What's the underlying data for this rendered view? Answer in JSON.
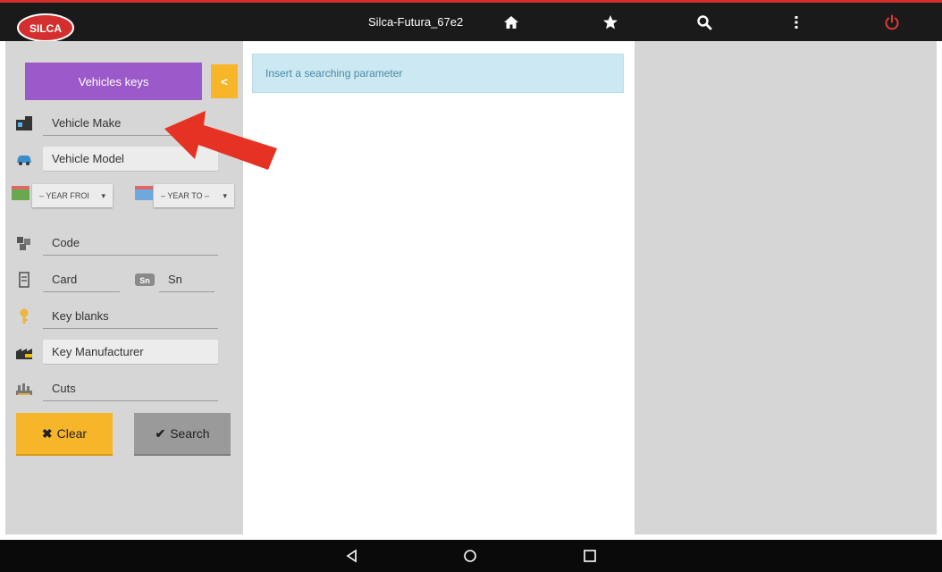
{
  "header": {
    "logo_text": "SILCA",
    "title": "Silca-Futura_67e2",
    "icons": [
      "home-icon",
      "star-icon",
      "search-icon",
      "more-vert-icon",
      "power-icon"
    ]
  },
  "sidebar": {
    "vehicles_keys_label": "Vehicles keys",
    "collapse_label": "<",
    "vehicle_make": "Vehicle Make",
    "vehicle_model": "Vehicle Model",
    "year_from": "– YEAR FROI",
    "year_to": "– YEAR TO –",
    "code": "Code",
    "card": "Card",
    "sn": "Sn",
    "key_blanks": "Key blanks",
    "key_manufacturer": "Key Manufacturer",
    "cuts": "Cuts",
    "clear_label": "Clear",
    "search_label": "Search"
  },
  "main": {
    "info_message": "Insert a searching parameter"
  },
  "colors": {
    "accent_purple": "#9b59c9",
    "accent_orange": "#f7b52a",
    "power_red": "#e53935",
    "annotation_arrow": "#e53222"
  }
}
